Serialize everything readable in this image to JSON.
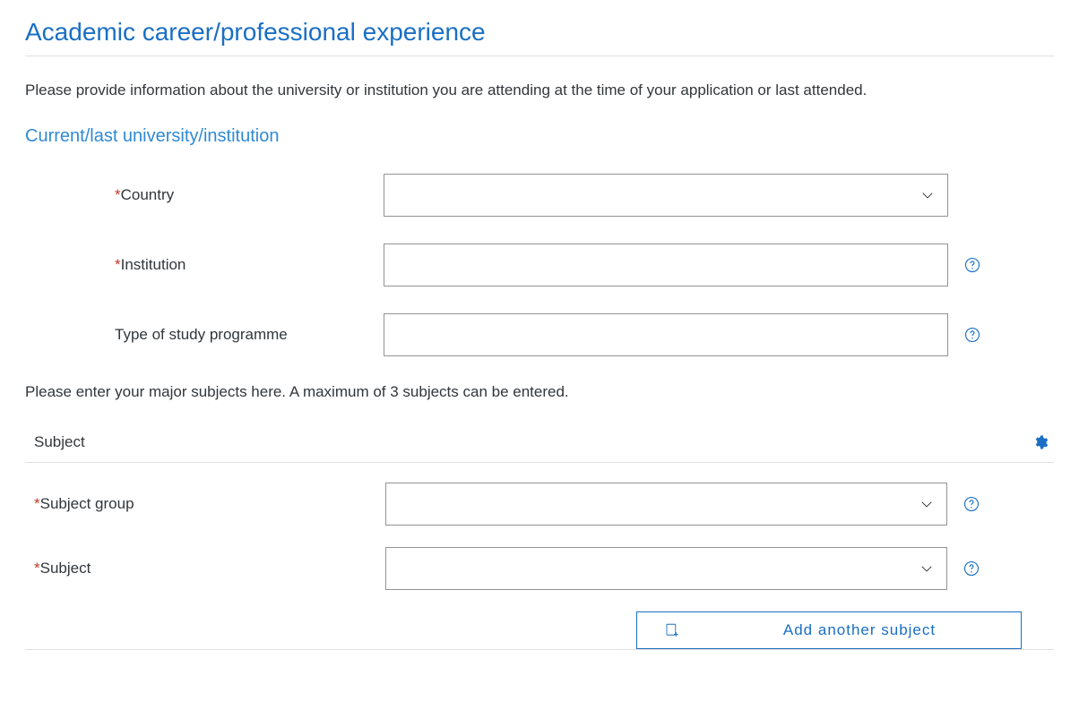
{
  "page_title": "Academic career/professional experience",
  "intro": "Please provide information about the university or institution you are attending at the time of your application or last attended.",
  "section_title": "Current/last university/institution",
  "fields": {
    "country": {
      "label": "Country",
      "value": ""
    },
    "institution": {
      "label": "Institution",
      "value": ""
    },
    "programme": {
      "label": "Type of study programme",
      "value": ""
    }
  },
  "subjects_intro": "Please enter your major subjects here. A maximum of 3 subjects can be entered.",
  "subject_header": "Subject",
  "subject_fields": {
    "group": {
      "label": "Subject group",
      "value": ""
    },
    "subject": {
      "label": "Subject",
      "value": ""
    }
  },
  "add_button": "Add another subject"
}
